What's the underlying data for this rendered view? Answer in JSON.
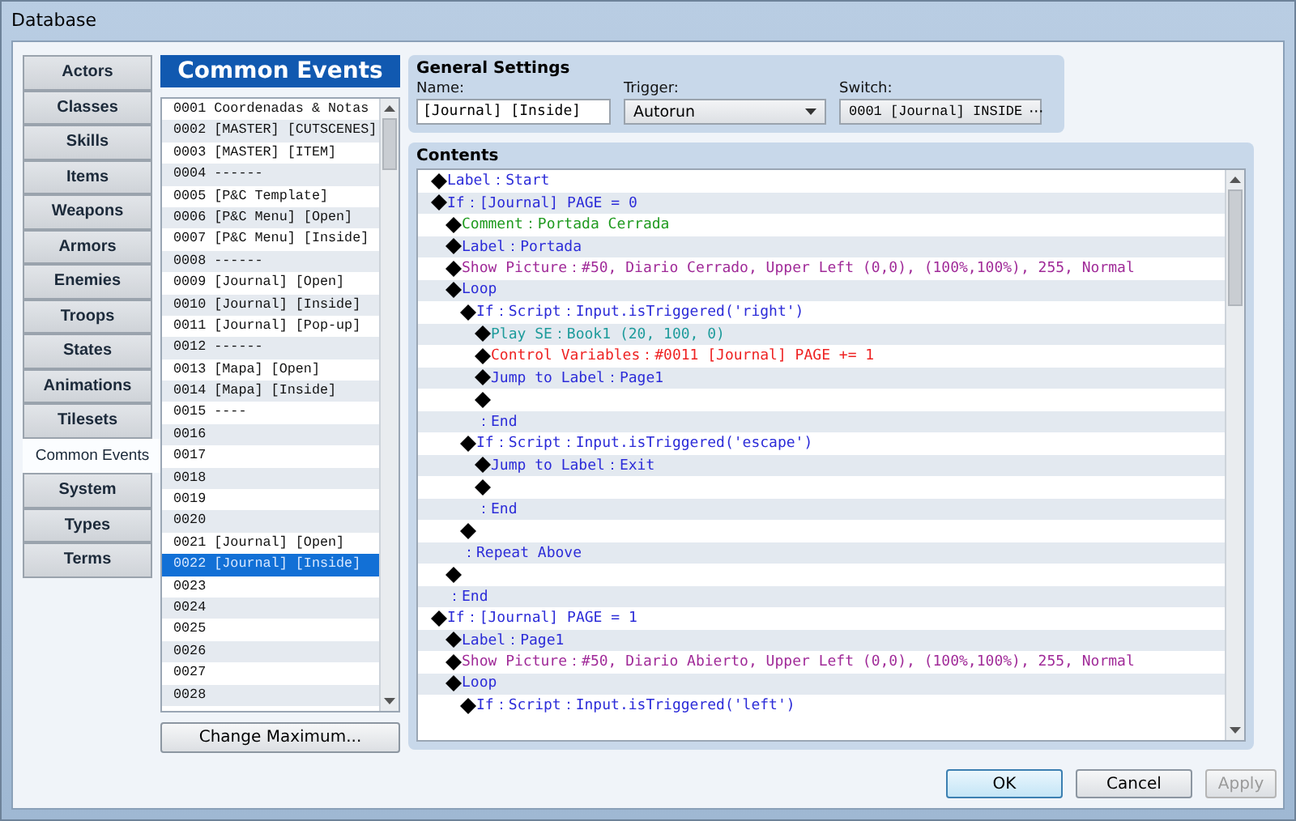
{
  "window": {
    "title": "Database"
  },
  "tabs": [
    {
      "label": "Actors",
      "selected": false
    },
    {
      "label": "Classes",
      "selected": false
    },
    {
      "label": "Skills",
      "selected": false
    },
    {
      "label": "Items",
      "selected": false
    },
    {
      "label": "Weapons",
      "selected": false
    },
    {
      "label": "Armors",
      "selected": false
    },
    {
      "label": "Enemies",
      "selected": false
    },
    {
      "label": "Troops",
      "selected": false
    },
    {
      "label": "States",
      "selected": false
    },
    {
      "label": "Animations",
      "selected": false
    },
    {
      "label": "Tilesets",
      "selected": false
    },
    {
      "label": "Common Events",
      "selected": true
    },
    {
      "label": "System",
      "selected": false
    },
    {
      "label": "Types",
      "selected": false
    },
    {
      "label": "Terms",
      "selected": false
    }
  ],
  "event_list": {
    "title": "Common Events",
    "items": [
      {
        "label": "0001 Coordenadas & Notas",
        "selected": false
      },
      {
        "label": "0002 [MASTER] [CUTSCENES]",
        "selected": false
      },
      {
        "label": "0003 [MASTER] [ITEM]",
        "selected": false
      },
      {
        "label": "0004 ------",
        "selected": false
      },
      {
        "label": "0005 [P&C Template]",
        "selected": false
      },
      {
        "label": "0006 [P&C Menu] [Open]",
        "selected": false
      },
      {
        "label": "0007 [P&C Menu] [Inside]",
        "selected": false
      },
      {
        "label": "0008 ------",
        "selected": false
      },
      {
        "label": "0009 [Journal] [Open]",
        "selected": false
      },
      {
        "label": "0010 [Journal] [Inside]",
        "selected": false
      },
      {
        "label": "0011 [Journal] [Pop-up]",
        "selected": false
      },
      {
        "label": "0012 ------",
        "selected": false
      },
      {
        "label": "0013 [Mapa] [Open]",
        "selected": false
      },
      {
        "label": "0014 [Mapa] [Inside]",
        "selected": false
      },
      {
        "label": "0015 ----",
        "selected": false
      },
      {
        "label": "0016",
        "selected": false
      },
      {
        "label": "0017",
        "selected": false
      },
      {
        "label": "0018",
        "selected": false
      },
      {
        "label": "0019",
        "selected": false
      },
      {
        "label": "0020",
        "selected": false
      },
      {
        "label": "0021 [Journal] [Open]",
        "selected": false
      },
      {
        "label": "0022 [Journal] [Inside]",
        "selected": true
      },
      {
        "label": "0023",
        "selected": false
      },
      {
        "label": "0024",
        "selected": false
      },
      {
        "label": "0025",
        "selected": false
      },
      {
        "label": "0026",
        "selected": false
      },
      {
        "label": "0027",
        "selected": false
      },
      {
        "label": "0028",
        "selected": false
      }
    ],
    "button": "Change Maximum..."
  },
  "general_settings": {
    "title": "General Settings",
    "name_label": "Name:",
    "name_value": "[Journal] [Inside]",
    "trigger_label": "Trigger:",
    "trigger_value": "Autorun",
    "switch_label": "Switch:",
    "switch_value": "0001 [Journal] INSIDE",
    "switch_button": "···"
  },
  "contents": {
    "title": "Contents",
    "commands": [
      {
        "kind": "command",
        "text": "Label：Start",
        "color": "#2b2bd8"
      },
      {
        "kind": "command",
        "text": "If：[Journal] PAGE = 0",
        "color": "#2b2bd8",
        "children": [
          {
            "kind": "command",
            "text": "Comment：Portada Cerrada",
            "color": "#1e9a1e"
          },
          {
            "kind": "command",
            "text": "Label：Portada",
            "color": "#2b2bd8"
          },
          {
            "kind": "command",
            "text": "Show Picture：#50, Diario Cerrado, Upper Left (0,0), (100%,100%), 255, Normal",
            "color": "#a02a98"
          },
          {
            "kind": "command",
            "text": "Loop",
            "color": "#2b2bd8",
            "children": [
              {
                "kind": "command",
                "text": "If：Script：Input.isTriggered('right')",
                "color": "#2b2bd8",
                "children": [
                  {
                    "kind": "command",
                    "text": "Play SE：Book1 (20, 100, 0)",
                    "color": "#1d9b9b"
                  },
                  {
                    "kind": "command",
                    "text": "Control Variables：#0011 [Journal] PAGE += 1",
                    "color": "#ee2222"
                  },
                  {
                    "kind": "command",
                    "text": "Jump to Label：Page1",
                    "color": "#2b2bd8"
                  },
                  {
                    "kind": "blank"
                  }
                ]
              },
              {
                "kind": "end",
                "text": "：End",
                "color": "#2b2bd8"
              },
              {
                "kind": "command",
                "text": "If：Script：Input.isTriggered('escape')",
                "color": "#2b2bd8",
                "children": [
                  {
                    "kind": "command",
                    "text": "Jump to Label：Exit",
                    "color": "#2b2bd8"
                  },
                  {
                    "kind": "blank"
                  }
                ]
              },
              {
                "kind": "end",
                "text": "：End",
                "color": "#2b2bd8"
              },
              {
                "kind": "blank"
              }
            ]
          },
          {
            "kind": "end",
            "text": "：Repeat Above",
            "color": "#2b2bd8"
          },
          {
            "kind": "blank"
          }
        ]
      },
      {
        "kind": "end",
        "text": "：End",
        "color": "#2b2bd8"
      },
      {
        "kind": "command",
        "text": "If：[Journal] PAGE = 1",
        "color": "#2b2bd8",
        "children": [
          {
            "kind": "command",
            "text": "Label：Page1",
            "color": "#2b2bd8"
          },
          {
            "kind": "command",
            "text": "Show Picture：#50, Diario Abierto, Upper Left (0,0), (100%,100%), 255, Normal",
            "color": "#a02a98"
          },
          {
            "kind": "command",
            "text": "Loop",
            "color": "#2b2bd8",
            "children": [
              {
                "kind": "command",
                "text": "If：Script：Input.isTriggered('left')",
                "color": "#2b2bd8"
              }
            ]
          }
        ]
      }
    ]
  },
  "buttons": [
    {
      "label": "OK",
      "kind": "default"
    },
    {
      "label": "Cancel",
      "kind": "normal"
    },
    {
      "label": "Apply",
      "kind": "disabled"
    }
  ]
}
